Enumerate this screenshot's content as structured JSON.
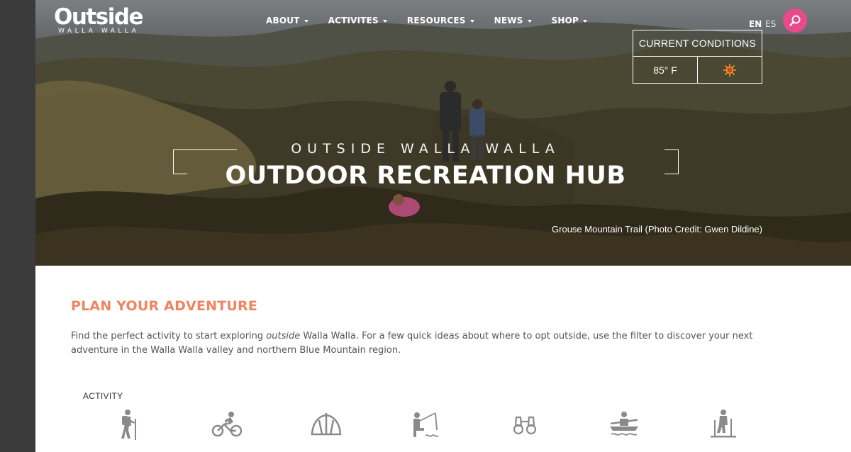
{
  "brand": {
    "name": "Outside",
    "tagline": "WALLA WALLA"
  },
  "nav": [
    {
      "label": "ABOUT"
    },
    {
      "label": "ACTIVITES"
    },
    {
      "label": "RESOURCES"
    },
    {
      "label": "NEWS"
    },
    {
      "label": "SHOP"
    }
  ],
  "language": {
    "active": "EN",
    "alternate": "ES"
  },
  "search": {
    "icon": "search-icon"
  },
  "conditions": {
    "title": "CURRENT CONDITIONS",
    "temperature": "85° F",
    "weather_icon": "sun-icon"
  },
  "hero": {
    "kicker": "OUTSIDE WALLA WALLA",
    "title": "OUTDOOR RECREATION HUB",
    "photo_credit": "Grouse Mountain Trail (Photo Credit: Gwen Dildine)"
  },
  "plan": {
    "title": "PLAN YOUR ADVENTURE",
    "intro_before": "Find the perfect activity to start exploring ",
    "intro_em": "outside",
    "intro_after": " Walla Walla. For a few quick ideas about where to opt outside, use the filter to discover your next adventure in the Walla Walla valley and northern Blue Mountain region."
  },
  "activity": {
    "label": "ACTIVITY",
    "icons": [
      "hiking-icon",
      "biking-icon",
      "camping-icon",
      "fishing-icon",
      "birding-icon",
      "paddling-icon",
      "skiing-icon"
    ]
  },
  "colors": {
    "accent": "#ee8560",
    "search": "#e84a8a",
    "icon_gray": "#8a8a8a"
  }
}
